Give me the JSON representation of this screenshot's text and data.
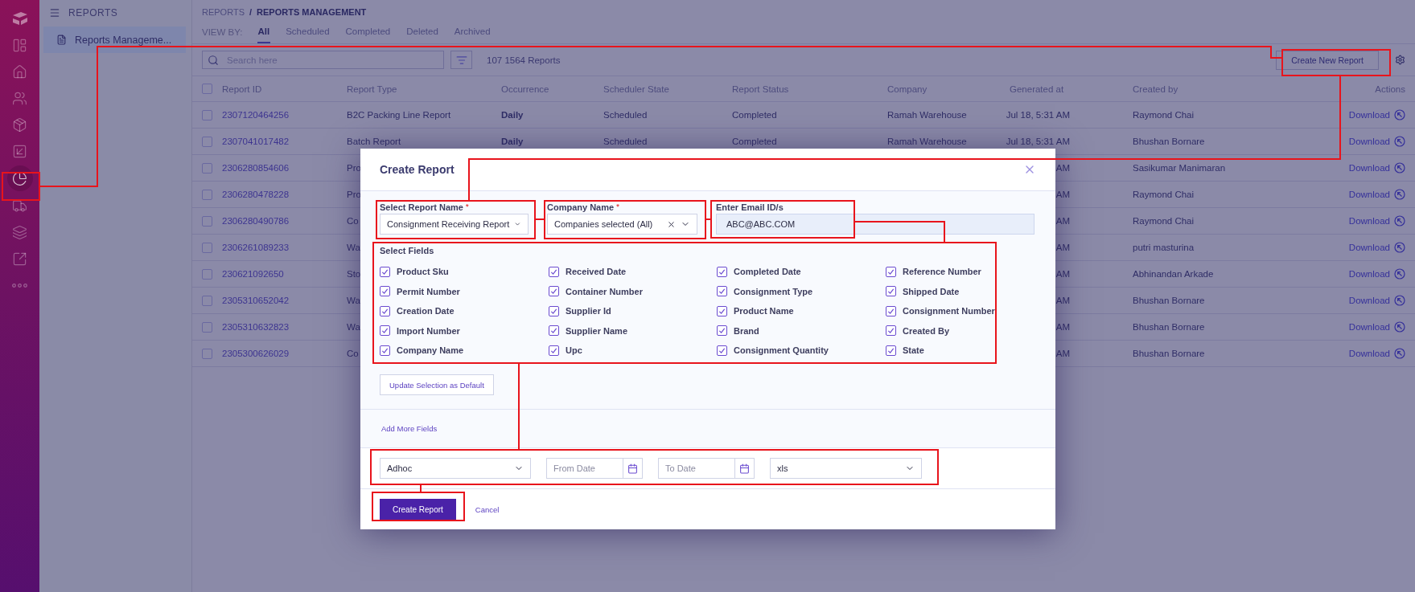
{
  "rail_items": [
    {
      "selected": false
    },
    {
      "selected": false
    },
    {
      "selected": false
    },
    {
      "selected": false
    },
    {
      "selected": false
    },
    {
      "selected": false
    },
    {
      "selected": true
    },
    {
      "selected": false
    },
    {
      "selected": false
    },
    {
      "selected": false
    },
    {
      "selected": false
    }
  ],
  "sidebar": {
    "title": "REPORTS",
    "items": [
      {
        "label": "Reports Manageme...",
        "selected": true
      }
    ]
  },
  "breadcrumb": {
    "parent": "REPORTS",
    "separator": "/",
    "current": "REPORTS MANAGEMENT"
  },
  "view_by": {
    "label": "VIEW BY:",
    "tabs": [
      {
        "label": "All",
        "selected": true
      },
      {
        "label": "Scheduled",
        "selected": false
      },
      {
        "label": "Completed",
        "selected": false
      },
      {
        "label": "Deleted",
        "selected": false
      },
      {
        "label": "Archived",
        "selected": false
      }
    ]
  },
  "toolbar": {
    "search_placeholder": "Search here",
    "count": "107 1564 Reports",
    "create_button": "Create New Report"
  },
  "table": {
    "header_checked": false,
    "columns": [
      "Report ID",
      "Report Type",
      "Occurrence",
      "Scheduler State",
      "Report Status",
      "Company",
      "Generated at",
      "Created by",
      "Actions"
    ],
    "rows": [
      {
        "checked": false,
        "report_id": "2307120464256",
        "report_type": "B2C Packing Line Report",
        "occurrence": "Daily",
        "scheduler_state": "Scheduled",
        "report_status": "Completed",
        "company": "Ramah Warehouse",
        "generated_at": "Jul 18, 5:31 AM",
        "created_by": "Raymond Chai",
        "action": "Download"
      },
      {
        "checked": false,
        "report_id": "2307041017482",
        "report_type": "Batch Report",
        "occurrence": "Daily",
        "scheduler_state": "Scheduled",
        "report_status": "Completed",
        "company": "Ramah Warehouse",
        "generated_at": "Jul 18, 5:31 AM",
        "created_by": "Bhushan Bornare",
        "action": "Download"
      },
      {
        "checked": false,
        "report_id": "2306280854606",
        "report_type": "Pro",
        "generated_at": "AM",
        "created_by": "Sasikumar Manimaran",
        "action": "Download"
      },
      {
        "checked": false,
        "report_id": "2306280478228",
        "report_type": "Pro",
        "generated_at": "AM",
        "created_by": "Raymond Chai",
        "action": "Download"
      },
      {
        "checked": false,
        "report_id": "2306280490786",
        "report_type": "Co",
        "generated_at": "AM",
        "created_by": "Raymond Chai",
        "action": "Download"
      },
      {
        "checked": false,
        "report_id": "2306261089233",
        "report_type": "Wa",
        "generated_at": "AM",
        "created_by": "putri masturina",
        "action": "Download"
      },
      {
        "checked": false,
        "report_id": "230621092650",
        "report_type": "Sto",
        "generated_at": "AM",
        "created_by": "Abhinandan Arkade",
        "action": "Download"
      },
      {
        "checked": false,
        "report_id": "2305310652042",
        "report_type": "Wa",
        "generated_at": "AM",
        "created_by": "Bhushan Bornare",
        "action": "Download"
      },
      {
        "checked": false,
        "report_id": "2305310632823",
        "report_type": "Wa",
        "generated_at": "AM",
        "created_by": "Bhushan Bornare",
        "action": "Download"
      },
      {
        "checked": false,
        "report_id": "2305300626029",
        "report_type": "Co",
        "generated_at": "AM",
        "created_by": "Bhushan Bornare",
        "action": "Download"
      }
    ]
  },
  "modal": {
    "title": "Create Report",
    "report_name": {
      "label": "Select Report Name",
      "required_mark": "*",
      "value": "Consignment Receiving Report"
    },
    "company": {
      "label": "Company Name",
      "required_mark": "*",
      "value": "Companies selected (All)"
    },
    "email": {
      "label": "Enter Email ID/s",
      "value": "ABC@ABC.COM"
    },
    "select_fields": {
      "label": "Select Fields",
      "items": [
        {
          "label": "Product Sku",
          "checked": true
        },
        {
          "label": "Received Date",
          "checked": true
        },
        {
          "label": "Completed Date",
          "checked": true
        },
        {
          "label": "Reference Number",
          "checked": true
        },
        {
          "label": "Permit Number",
          "checked": true
        },
        {
          "label": "Container Number",
          "checked": true
        },
        {
          "label": "Consignment Type",
          "checked": true
        },
        {
          "label": "Shipped Date",
          "checked": true
        },
        {
          "label": "Creation Date",
          "checked": true
        },
        {
          "label": "Supplier Id",
          "checked": true
        },
        {
          "label": "Product Name",
          "checked": true
        },
        {
          "label": "Consignment Number",
          "checked": true
        },
        {
          "label": "Import Number",
          "checked": true
        },
        {
          "label": "Supplier Name",
          "checked": true
        },
        {
          "label": "Brand",
          "checked": true
        },
        {
          "label": "Created By",
          "checked": true
        },
        {
          "label": "Company Name",
          "checked": true
        },
        {
          "label": "Upc",
          "checked": true
        },
        {
          "label": "Consignment Quantity",
          "checked": true
        },
        {
          "label": "State",
          "checked": true
        }
      ]
    },
    "update_button": "Update Selection as Default",
    "add_more": "Add More Fields",
    "schedule": {
      "occurrence": "Adhoc",
      "from_placeholder": "From Date",
      "to_placeholder": "To Date",
      "format": "xls"
    },
    "create_button": "Create Report",
    "cancel": "Cancel"
  }
}
